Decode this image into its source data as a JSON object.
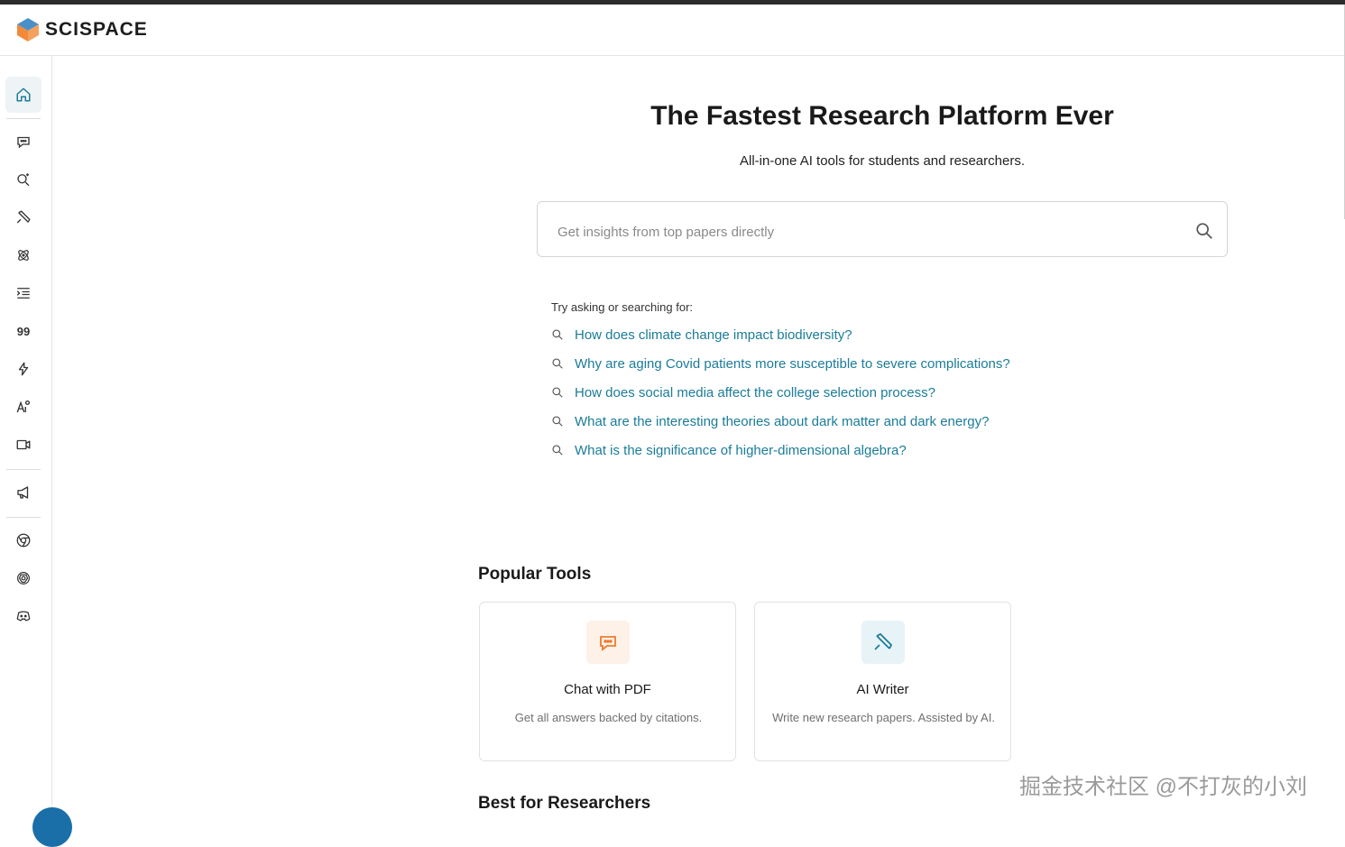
{
  "app": {
    "logo_text": "SCISPACE",
    "brand_colors": {
      "orange": "#f28a3a",
      "blue": "#4a90c8",
      "accent_link": "#1b7c99"
    }
  },
  "sidebar": {
    "items": [
      {
        "icon": "home-icon",
        "active": true
      },
      {
        "icon": "chat-bubble-icon"
      },
      {
        "icon": "search-sparkle-icon"
      },
      {
        "icon": "pen-writer-icon"
      },
      {
        "icon": "atom-icon"
      },
      {
        "icon": "list-indent-icon"
      },
      {
        "icon": "quote-icon",
        "text": "99"
      },
      {
        "icon": "lightning-icon"
      },
      {
        "icon": "ai-text-icon",
        "text": "A"
      },
      {
        "icon": "video-icon"
      },
      {
        "icon": "megaphone-icon"
      },
      {
        "icon": "chrome-icon"
      },
      {
        "icon": "openai-icon"
      },
      {
        "icon": "discord-icon"
      }
    ]
  },
  "hero": {
    "title": "The Fastest Research Platform Ever",
    "subtitle": "All-in-one AI tools for students and researchers."
  },
  "search": {
    "placeholder": "Get insights from top papers directly",
    "value": ""
  },
  "suggestions": {
    "label": "Try asking or searching for:",
    "items": [
      "How does climate change impact biodiversity?",
      "Why are aging Covid patients more susceptible to severe complications?",
      "How does social media affect the college selection process?",
      "What are the interesting theories about dark matter and dark energy?",
      "What is the significance of higher-dimensional algebra?"
    ]
  },
  "popular_tools": {
    "title": "Popular Tools",
    "cards": [
      {
        "title": "Chat with PDF",
        "desc": "Get all answers backed by citations.",
        "icon": "chat-bubble-icon"
      },
      {
        "title": "AI Writer",
        "desc": "Write new research papers. Assisted by AI.",
        "icon": "pen-writer-icon"
      }
    ]
  },
  "best_for_researchers": {
    "title": "Best for Researchers"
  },
  "watermark": "掘金技术社区 @不打灰的小刘"
}
